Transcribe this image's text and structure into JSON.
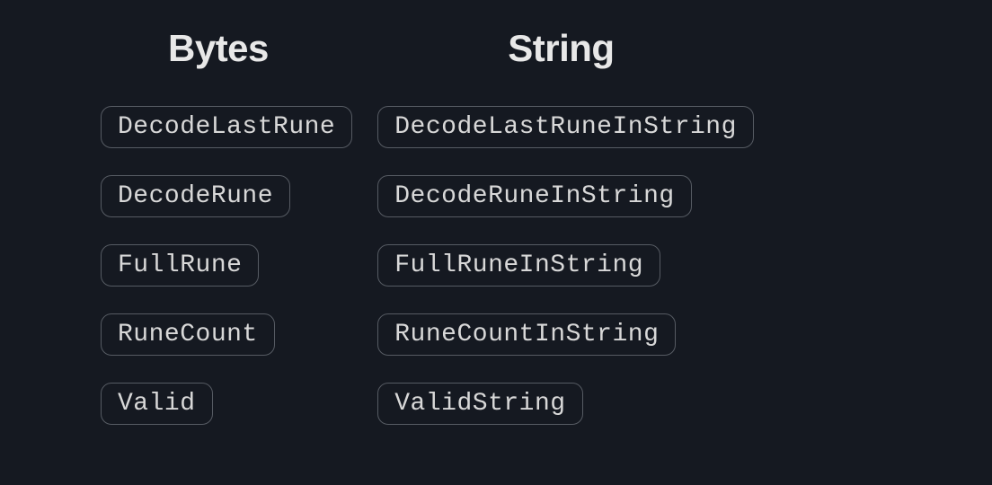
{
  "columns": [
    {
      "heading": "Bytes",
      "items": [
        "DecodeLastRune",
        "DecodeRune",
        "FullRune",
        "RuneCount",
        "Valid"
      ]
    },
    {
      "heading": "String",
      "items": [
        "DecodeLastRuneInString",
        "DecodeRuneInString",
        "FullRuneInString",
        "RuneCountInString",
        "ValidString"
      ]
    }
  ]
}
